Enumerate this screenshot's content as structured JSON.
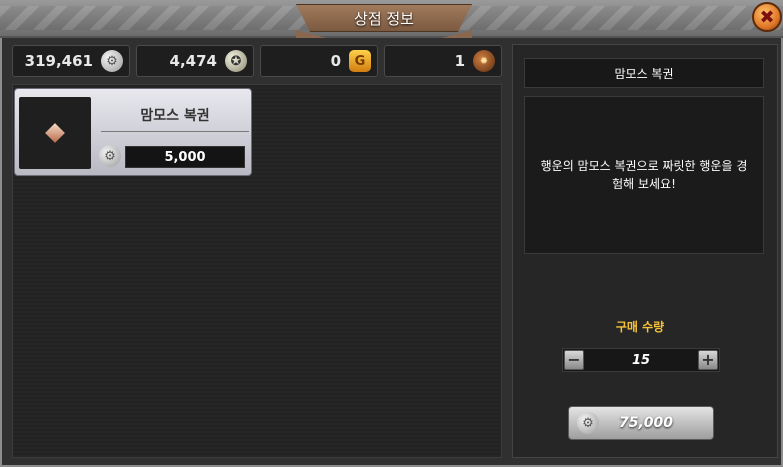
{
  "window": {
    "title": "상점 정보",
    "close_symbol": "✖"
  },
  "currencies": [
    {
      "value": "319,461",
      "icon": "silver-coin-icon",
      "symbol": "⚙"
    },
    {
      "value": "4,474",
      "icon": "medal-icon",
      "symbol": "✪"
    },
    {
      "value": "0",
      "icon": "gold-icon",
      "symbol": "G"
    },
    {
      "value": "1",
      "icon": "ticket-icon",
      "symbol": "✹"
    }
  ],
  "item": {
    "name": "맘모스 복권",
    "price": "5,000",
    "price_icon": "silver-coin-icon",
    "price_symbol": "⚙"
  },
  "detail": {
    "title": "맘모스 복권",
    "description": "행운의 맘모스 복권으로 짜릿한 행운을 경험해 보세요!"
  },
  "purchase": {
    "qty_label": "구매 수량",
    "minus": "−",
    "plus": "+",
    "quantity": "15",
    "total": "75,000",
    "total_icon": "silver-coin-icon",
    "total_symbol": "⚙"
  }
}
